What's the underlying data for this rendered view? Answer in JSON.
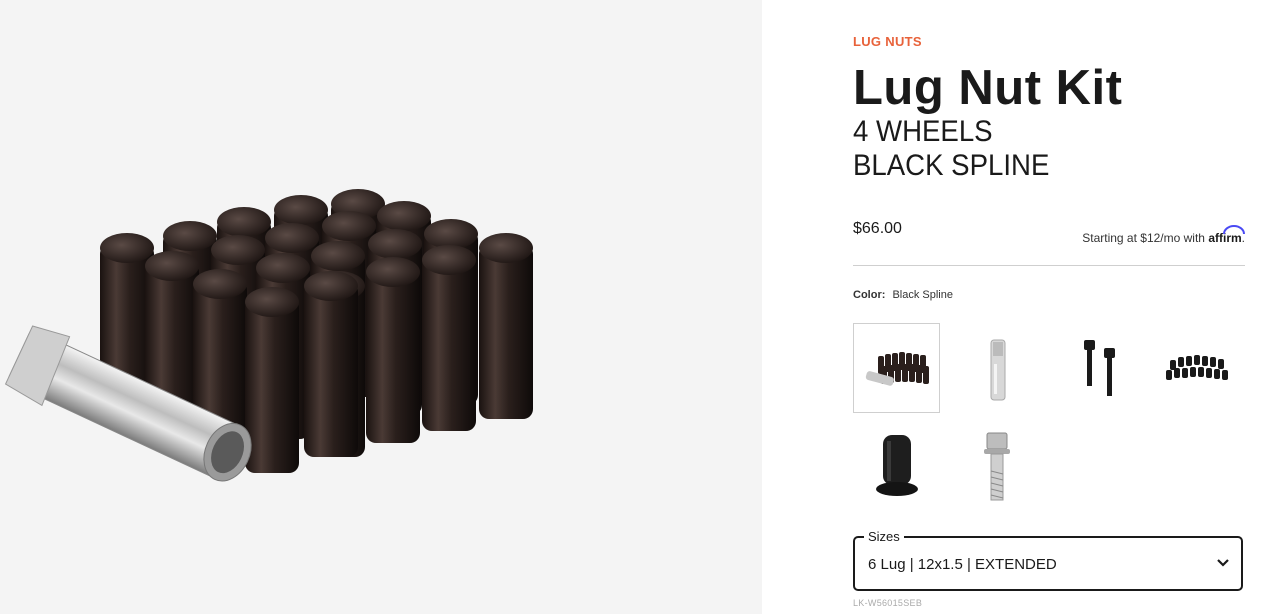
{
  "product": {
    "category": "LUG NUTS",
    "title": "Lug Nut Kit",
    "subtitle_line1": "4 WHEELS",
    "subtitle_line2": "BLACK SPLINE",
    "price": "$66.00",
    "financing_text": "Starting at $12/mo with",
    "affirm_brand": "affirm",
    "color_label": "Color:",
    "color_value": "Black Spline",
    "sizes_label": "Sizes",
    "sizes_value": "6 Lug | 12x1.5 | EXTENDED",
    "sku": "LK-W56015SEB"
  },
  "swatches": [
    {
      "icon": "lug-nut-kit-black-icon",
      "selected": true
    },
    {
      "icon": "socket-key-icon",
      "selected": false
    },
    {
      "icon": "lug-bolts-black-icon",
      "selected": false
    },
    {
      "icon": "lug-nut-set-black-icon",
      "selected": false
    },
    {
      "icon": "single-lug-nut-black-icon",
      "selected": false
    },
    {
      "icon": "single-lug-bolt-chrome-icon",
      "selected": false
    }
  ],
  "colors": {
    "accent": "#e8623a",
    "text": "#1a1a1a",
    "affirm_blue": "#4a4af4",
    "image_bg": "#f4f4f4"
  }
}
